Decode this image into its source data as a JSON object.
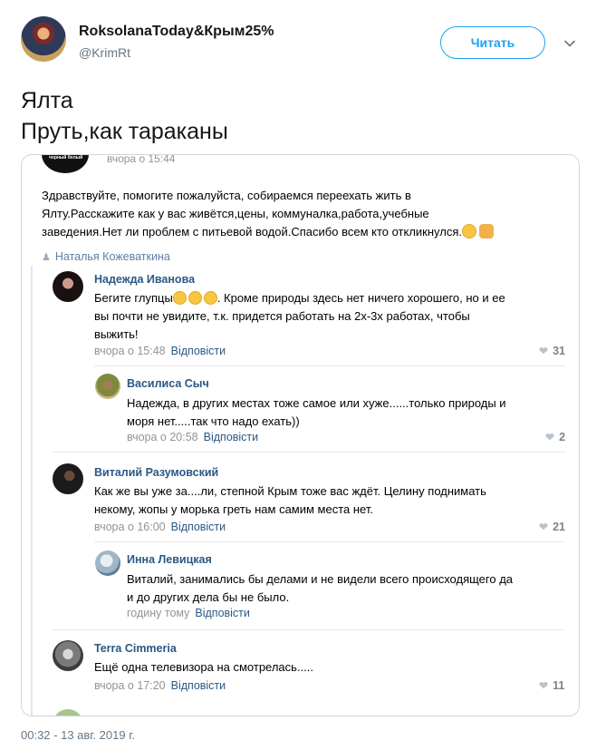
{
  "tweet": {
    "display_name": "RoksolanaToday&Крым25%",
    "handle": "@KrimRt",
    "follow_label": "Читать",
    "text_line1": "Ялта",
    "text_line2": "Пруть,как тараканы",
    "timestamp": "00:32 - 13 авг. 2019 г."
  },
  "post": {
    "time": "вчора о 15:44",
    "text_line1": "Здравствуйте, помогите пожалуйста, собираемся переехать жить в",
    "text_line2": "Ялту.Расскажите как у вас живётся,цены, коммуналка,работа,учебные",
    "text_line3": "заведения.Нет ли проблем с питьевой водой.Спасибо всем кто откликнулся.",
    "author": "Наталья Кожеваткина"
  },
  "comments": [
    {
      "name": "Надежда Иванова",
      "line1": "Бегите глупцы",
      "line1b": ". Кроме природы здесь нет ничего хорошего, но и ее",
      "line2": "вы почти не увидите, т.к. придется работать на 2х-3х работах, чтобы",
      "line3": "выжить!",
      "time": "вчора о 15:48",
      "reply": "Відповісти",
      "likes": "31"
    },
    {
      "name": "Василиса Сыч",
      "line1": "Надежда, в других местах тоже самое или хуже......только природы и",
      "line2": "моря нет.....так что надо ехать))",
      "time": "вчора о 20:58",
      "reply": "Відповісти",
      "likes": "2"
    },
    {
      "name": "Виталий Разумовский",
      "line1": "Как же вы уже за....ли, степной Крым тоже вас ждёт. Целину поднимать",
      "line2": "некому, жопы у морька греть нам самим места нет.",
      "time": "вчора о 16:00",
      "reply": "Відповісти",
      "likes": "21"
    },
    {
      "name": "Инна Левицкая",
      "line1": "Виталий, занимались бы делами и не видели всего происходящего да",
      "line2": "и до других дела бы не было.",
      "time": "годину тому",
      "reply": "Відповісти"
    },
    {
      "name": "Terra Cimmeria",
      "line1": "Ещё одна телевизора на смотрелась.....",
      "time": "вчора о 17:20",
      "reply": "Відповісти",
      "likes": "11"
    }
  ],
  "icons": {
    "heart": "heart-icon",
    "chevron": "chevron-down-icon",
    "person": "person-icon"
  },
  "colors": {
    "twitter_blue": "#1da1f2",
    "vk_link": "#2a5885"
  }
}
